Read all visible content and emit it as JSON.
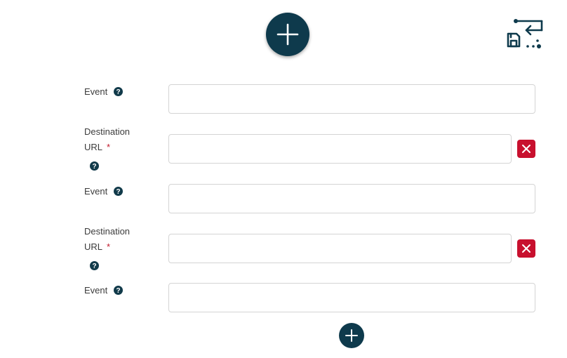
{
  "toolbar": {
    "add_icon": "plus-icon",
    "save_return_icon": "save-and-return-icon"
  },
  "colors": {
    "primary": "#0e3a4c",
    "danger": "#c8102e",
    "required": "#c0182a",
    "border": "#d4d4d4"
  },
  "rows": [
    {
      "type": "event",
      "label": "Event",
      "value": ""
    },
    {
      "type": "destination",
      "label_line1": "Destination",
      "label_line2": "URL",
      "required_mark": "*",
      "value": "",
      "remove_icon": "close-icon"
    },
    {
      "type": "event",
      "label": "Event",
      "value": ""
    },
    {
      "type": "destination",
      "label_line1": "Destination",
      "label_line2": "URL",
      "required_mark": "*",
      "value": "",
      "remove_icon": "close-icon"
    },
    {
      "type": "event",
      "label": "Event",
      "value": ""
    }
  ],
  "help_icon": "question-circle-icon"
}
